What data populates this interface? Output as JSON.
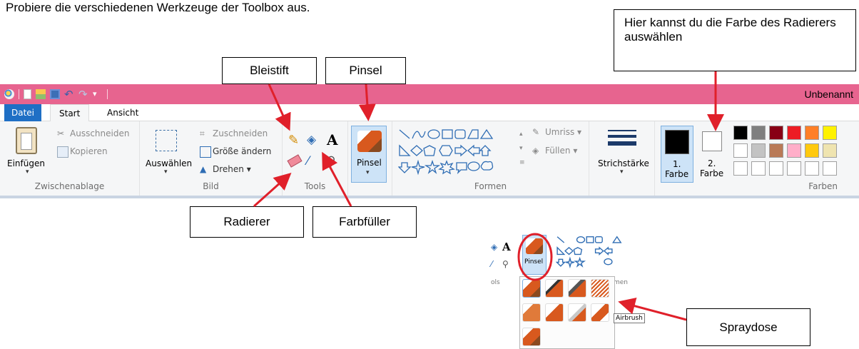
{
  "instruction": "Probiere die verschiedenen Werkzeuge der Toolbox aus.",
  "callouts": {
    "eraser_color": "Hier kannst du die Farbe des Radierers auswählen",
    "pencil": "Bleistift",
    "brush": "Pinsel",
    "eraser": "Radierer",
    "fill": "Farbfüller",
    "spray": "Spraydose"
  },
  "window": {
    "title": "Unbenannt"
  },
  "tabs": [
    {
      "label": "Datei"
    },
    {
      "label": "Start"
    },
    {
      "label": "Ansicht"
    }
  ],
  "clipboard": {
    "paste_label": "Einfügen",
    "cut_label": "Ausschneiden",
    "copy_label": "Kopieren",
    "group_label": "Zwischenablage"
  },
  "image": {
    "select_label": "Auswählen",
    "crop_label": "Zuschneiden",
    "resize_label": "Größe ändern",
    "rotate_label": "Drehen ▾",
    "group_label": "Bild"
  },
  "tools": {
    "group_label": "Tools",
    "text_glyph": "A"
  },
  "brushes": {
    "label": "Pinsel"
  },
  "shapes": {
    "outline_label": "Umriss ▾",
    "fill_label": "Füllen ▾",
    "group_label": "Formen"
  },
  "size": {
    "label": "Strichstärke"
  },
  "colors": {
    "color1_label": "1.",
    "color1_label2": "Farbe",
    "color2_label": "2.",
    "color2_label2": "Farbe",
    "group_label": "Farben",
    "color1": "#000000",
    "color2": "#ffffff",
    "palette_row1": [
      "#000000",
      "#7f7f7f",
      "#880015",
      "#ed1c24",
      "#ff7f27",
      "#fff200"
    ],
    "palette_row2": [
      "#ffffff",
      "#c3c3c3",
      "#b97a57",
      "#ffaec9",
      "#ffc90e",
      "#efe4b0"
    ]
  },
  "popup": {
    "text_glyph": "A",
    "brush_label": "Pinsel",
    "tools_partial": "ols",
    "shapes_partial": "men",
    "tooltip": "Airbrush"
  },
  "accent": {
    "ribbon_title": "#e7648f",
    "file_tab": "#1f6fc5",
    "arrow": "#e0202a"
  }
}
